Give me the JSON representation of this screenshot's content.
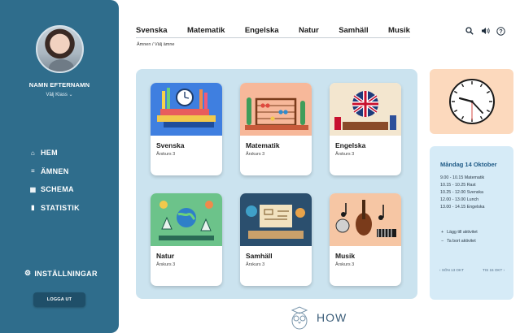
{
  "sidebar": {
    "user_name": "NAMN EFTERNAMN",
    "class_select": "Välj Klass",
    "nav": [
      {
        "icon": "home-icon",
        "label": "HEM"
      },
      {
        "icon": "list-icon",
        "label": "ÄMNEN"
      },
      {
        "icon": "calendar-icon",
        "label": "SCHEMA"
      },
      {
        "icon": "bar-chart-icon",
        "label": "STATISTIK"
      }
    ],
    "settings_label": "INSTÄLLNINGAR",
    "logout_label": "LOGGA UT"
  },
  "topnav": {
    "tabs": [
      "Svenska",
      "Matematik",
      "Engelska",
      "Natur",
      "Samhäll",
      "Musik"
    ],
    "breadcrumb": "Ämnen / Välj ämne",
    "icons": [
      "search-icon",
      "speaker-icon",
      "help-icon"
    ]
  },
  "subjects": [
    {
      "title": "Svenska",
      "grade": "Årskurs 3",
      "color": "#3f7fe0"
    },
    {
      "title": "Matematik",
      "grade": "Årskurs 3",
      "color": "#f7b89a"
    },
    {
      "title": "Engelska",
      "grade": "Årskurs 3",
      "color": "#f3e6cf"
    },
    {
      "title": "Natur",
      "grade": "Årskurs 3",
      "color": "#6cc38a"
    },
    {
      "title": "Samhäll",
      "grade": "Årskurs 3",
      "color": "#2b4f6e"
    },
    {
      "title": "Musik",
      "grade": "Årskurs 3",
      "color": "#f6c6a4"
    }
  ],
  "schedule": {
    "day": "Måndag 14 Oktober",
    "events": [
      "9.00 - 10.15 Matematik",
      "10.15 - 10.25 Rast",
      "10.25 - 12.00 Svenska",
      "12.00 - 13.00 Lunch",
      "13.00 - 14.15 Engelska"
    ],
    "add_activity": "Lägg till aktivitet",
    "remove_activity": "Ta bort aktivitet",
    "prev_label": "SÖN 13 OKT",
    "next_label": "TIS 15 OKT"
  },
  "logo_text": "HOW"
}
